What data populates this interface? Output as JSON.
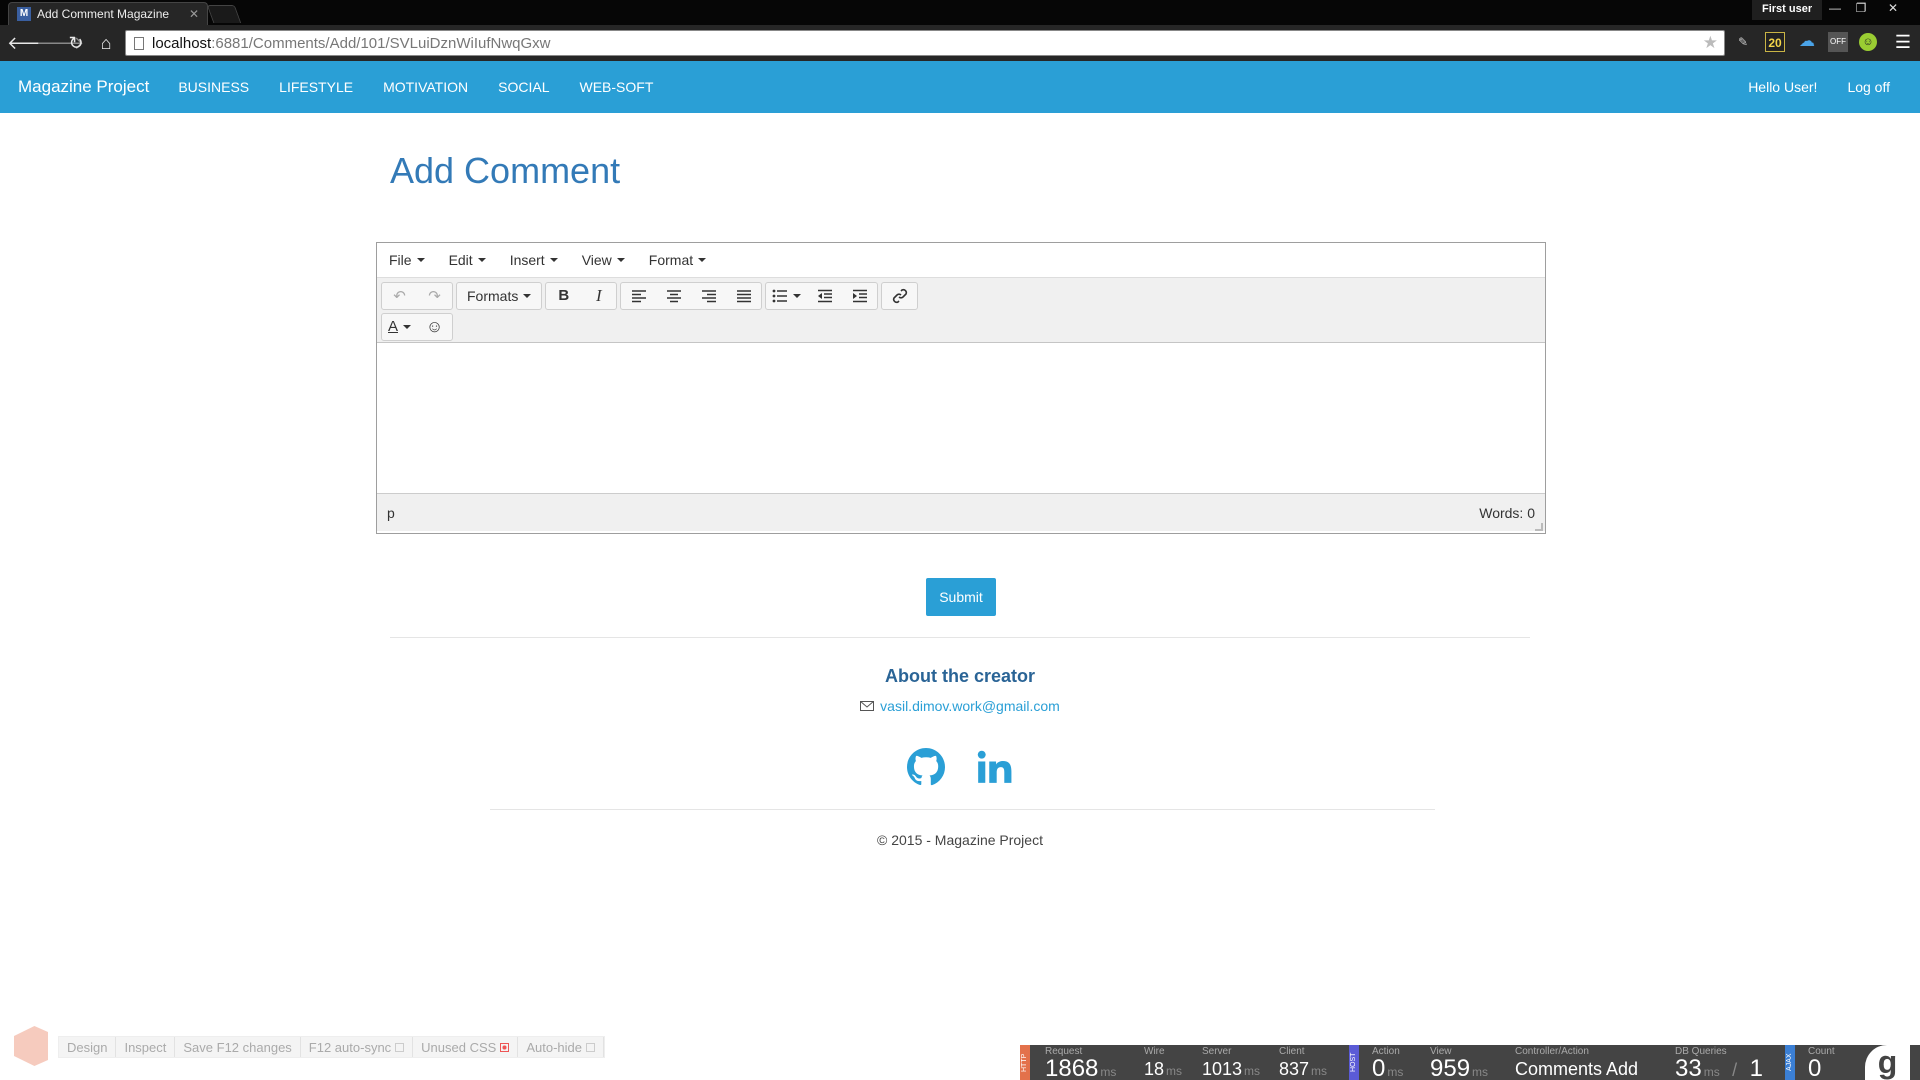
{
  "browser": {
    "tab_title": "Add Comment Magazine",
    "tab_favicon": "M",
    "profile_name": "First user",
    "url_host": "localhost",
    "url_path": ":6881/Comments/Add/101/SVLuiDznWiIufNwqGxw",
    "ext_badge": "20",
    "ext_off": "OFF"
  },
  "navbar": {
    "brand": "Magazine Project",
    "links": [
      "BUSINESS",
      "LIFESTYLE",
      "MOTIVATION",
      "SOCIAL",
      "WEB-SOFT"
    ],
    "greeting": "Hello User!",
    "logoff": "Log off"
  },
  "page": {
    "title": "Add Comment"
  },
  "editor": {
    "menus": [
      "File",
      "Edit",
      "Insert",
      "View",
      "Format"
    ],
    "formats_label": "Formats",
    "status_path": "p",
    "word_count": "Words: 0"
  },
  "form": {
    "submit_label": "Submit"
  },
  "footer": {
    "about_title": "About the creator",
    "email": "vasil.dimov.work@gmail.com",
    "copyright": "© 2015 - Magazine Project"
  },
  "browserlink": {
    "items": [
      "Design",
      "Inspect",
      "Save F12 changes",
      "F12 auto-sync",
      "Unused CSS",
      "Auto-hide"
    ]
  },
  "glimpse": {
    "request_label": "Request",
    "request_value": "1868",
    "request_unit": "ms",
    "wire_label": "Wire",
    "wire_value": "18",
    "wire_unit": "ms",
    "server_label": "Server",
    "server_value": "1013",
    "server_unit": "ms",
    "client_label": "Client",
    "client_value": "837",
    "client_unit": "ms",
    "action_label": "Action",
    "action_value": "0",
    "action_unit": "ms",
    "view_label": "View",
    "view_value": "959",
    "view_unit": "ms",
    "controller_label": "Controller/Action",
    "controller_value": "Comments Add",
    "db_label": "DB Queries",
    "db_value": "33",
    "db_unit": "ms",
    "db_sep": "/",
    "db_count": "1",
    "count_label": "Count",
    "count_value": "0",
    "tag_http": "HTTP",
    "tag_host": "HOST",
    "tag_ajax": "AJAX",
    "logo": "g"
  }
}
